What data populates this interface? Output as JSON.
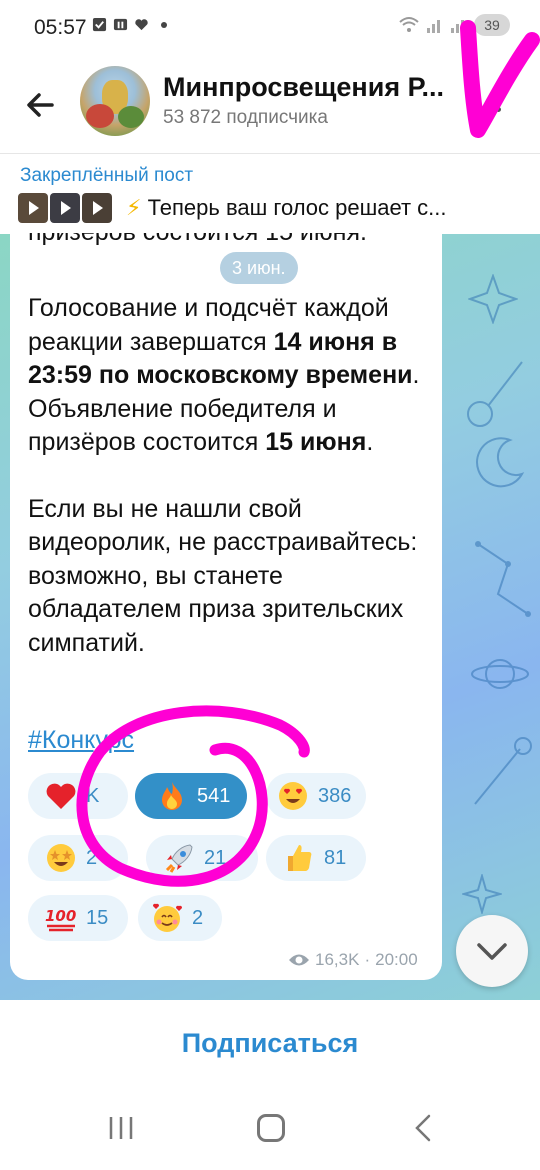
{
  "status_bar": {
    "time": "05:57",
    "battery": "39"
  },
  "header": {
    "title": "Минпросвещения Р...",
    "subscribers": "53 872 подписчика"
  },
  "pinned": {
    "label": "Закреплённый пост",
    "text": "Теперь ваш голос решает с..."
  },
  "message": {
    "cut_line": "призёров состоится 15 июня.",
    "date_chip": "3 июн.",
    "p1_a": "Голосование и подсчёт каждой реакции завершатся ",
    "p1_b": "14 июня в 23:59 по московскому времени",
    "p1_c": ". Объявление победителя и призёров состоится ",
    "p1_d": "15 июня",
    "p1_e": ".",
    "p2": "Если вы не нашли свой видеоролик, не расстраивайтесь: возможно, вы станете обладателем приза зрительских симпатий.",
    "hashtag": "#Конкурс",
    "views": "16,3K",
    "time": "20:00"
  },
  "reactions": [
    {
      "emoji": "heart",
      "count": "K"
    },
    {
      "emoji": "fire",
      "count": "541",
      "selected": true
    },
    {
      "emoji": "heart-eyes",
      "count": "386"
    },
    {
      "emoji": "star-struck",
      "count": "2"
    },
    {
      "emoji": "rocket",
      "count": "21"
    },
    {
      "emoji": "thumbs-up",
      "count": "81"
    },
    {
      "emoji": "hundred",
      "count": "15"
    },
    {
      "emoji": "smiling-hearts",
      "count": "2"
    }
  ],
  "bottom": {
    "subscribe_label": "Подписаться"
  },
  "colors": {
    "accent": "#2b8ad0",
    "reaction_bg": "#eaf4fb",
    "reaction_selected": "#3390c8",
    "annotation": "#ff00d4"
  }
}
